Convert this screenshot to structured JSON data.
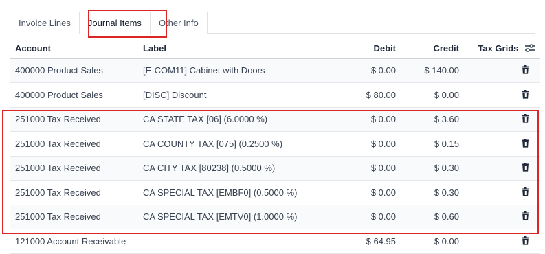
{
  "tabs": [
    {
      "label": "Invoice Lines"
    },
    {
      "label": "Journal Items"
    },
    {
      "label": "Other Info"
    }
  ],
  "columns": {
    "account": "Account",
    "label": "Label",
    "debit": "Debit",
    "credit": "Credit",
    "tax_grids": "Tax Grids"
  },
  "rows": [
    {
      "account": "400000 Product Sales",
      "label": "[E-COM11] Cabinet with Doors",
      "debit": "$ 0.00",
      "credit": "$ 140.00"
    },
    {
      "account": "400000 Product Sales",
      "label": "[DISC] Discount",
      "debit": "$ 80.00",
      "credit": "$ 0.00"
    },
    {
      "account": "251000 Tax Received",
      "label": "CA STATE TAX [06] (6.0000 %)",
      "debit": "$ 0.00",
      "credit": "$ 3.60"
    },
    {
      "account": "251000 Tax Received",
      "label": "CA COUNTY TAX [075] (0.2500 %)",
      "debit": "$ 0.00",
      "credit": "$ 0.15"
    },
    {
      "account": "251000 Tax Received",
      "label": "CA CITY TAX [80238] (0.5000 %)",
      "debit": "$ 0.00",
      "credit": "$ 0.30"
    },
    {
      "account": "251000 Tax Received",
      "label": "CA SPECIAL TAX [EMBF0] (0.5000 %)",
      "debit": "$ 0.00",
      "credit": "$ 0.30"
    },
    {
      "account": "251000 Tax Received",
      "label": "CA SPECIAL TAX [EMTV0] (1.0000 %)",
      "debit": "$ 0.00",
      "credit": "$ 0.60"
    },
    {
      "account": "121000 Account Receivable",
      "label": "",
      "debit": "$ 64.95",
      "credit": "$ 0.00"
    }
  ],
  "icons": {
    "row_action": "trash-icon",
    "column_settings": "sliders-icon"
  },
  "colors": {
    "highlight": "#dc2626"
  }
}
